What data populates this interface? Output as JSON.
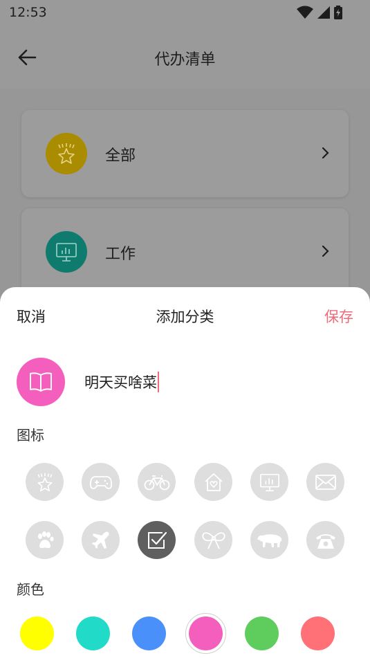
{
  "status": {
    "time": "12:53"
  },
  "header": {
    "title": "代办清单"
  },
  "cards": [
    {
      "label": "全部",
      "color": "#a98c00",
      "icon": "crown-star-icon"
    },
    {
      "label": "工作",
      "color": "#0f7a6e",
      "icon": "presentation-icon"
    }
  ],
  "sheet": {
    "cancel_label": "取消",
    "title": "添加分类",
    "save_label": "保存",
    "name_value": "明天买啥菜",
    "icons_label": "图标",
    "colors_label": "颜色",
    "preview_icon": "book-icon",
    "preview_color": "#f45fbd"
  },
  "icon_options": [
    "crown-star-icon",
    "gamepad-icon",
    "bicycle-icon",
    "home-heart-icon",
    "presentation-icon",
    "mail-icon",
    "paw-icon",
    "airplane-icon",
    "checkbox-icon",
    "bow-icon",
    "animal-icon",
    "telephone-icon"
  ],
  "selected_icon": "checkbox-icon",
  "colors": [
    "#ffff00",
    "#22dac8",
    "#4a90fa",
    "#f45fbd",
    "#5ecd5e",
    "#ff7176"
  ],
  "selected_color": "#f45fbd"
}
